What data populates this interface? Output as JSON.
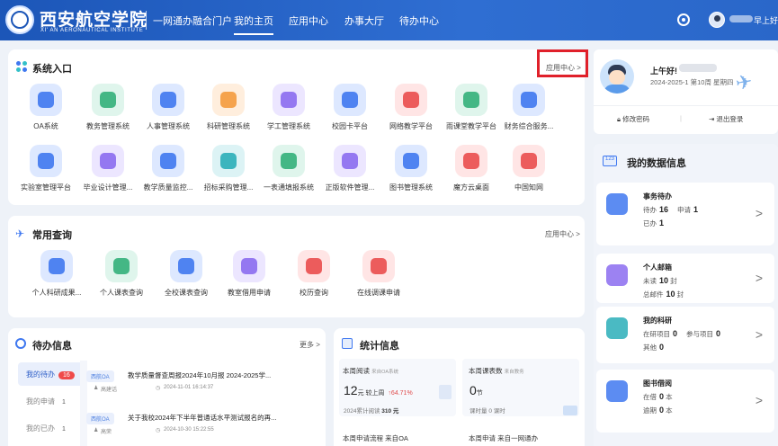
{
  "header": {
    "logo_text": "西安航空学院",
    "logo_en": "XI' AN AERONAUTICAL INSTITUTE",
    "portal_title": "一网通办融合门户",
    "nav": [
      "我的主页",
      "应用中心",
      "办事大厅",
      "待办中心"
    ],
    "active_nav": "我的主页",
    "greeting": "早上好",
    "icons": [
      "gear-icon",
      "avatar-icon"
    ]
  },
  "system_entry": {
    "title": "系统入口",
    "more": "应用中心 >",
    "apps": [
      {
        "label": "OA系统",
        "color": "blue"
      },
      {
        "label": "教务管理系统",
        "color": "green"
      },
      {
        "label": "人事管理系统",
        "color": "blue"
      },
      {
        "label": "科研管理系统",
        "color": "orange"
      },
      {
        "label": "学工管理系统",
        "color": "purple"
      },
      {
        "label": "校园卡平台",
        "color": "blue"
      },
      {
        "label": "网络教学平台",
        "color": "red"
      },
      {
        "label": "雨课堂教学平台",
        "color": "green"
      },
      {
        "label": "财务综合服务...",
        "color": "blue"
      },
      {
        "label": "实验室管理平台",
        "color": "blue"
      },
      {
        "label": "毕业设计管理...",
        "color": "purple"
      },
      {
        "label": "教学质量监控...",
        "color": "blue"
      },
      {
        "label": "招标采购管理...",
        "color": "teal"
      },
      {
        "label": "一表通填报系统",
        "color": "green"
      },
      {
        "label": "正版软件管理...",
        "color": "purple"
      },
      {
        "label": "图书管理系统",
        "color": "blue"
      },
      {
        "label": "魔方云桌面",
        "color": "red"
      },
      {
        "label": "中国知网",
        "color": "red"
      }
    ]
  },
  "common_query": {
    "title": "常用查询",
    "more": "应用中心 >",
    "items": [
      {
        "label": "个人科研成果...",
        "color": "blue"
      },
      {
        "label": "个人课表查询",
        "color": "green"
      },
      {
        "label": "全校课表查询",
        "color": "blue"
      },
      {
        "label": "教室借用申请",
        "color": "purple"
      },
      {
        "label": "校历查询",
        "color": "red"
      },
      {
        "label": "在线调课申请",
        "color": "red"
      }
    ]
  },
  "todo": {
    "title": "待办信息",
    "more": "更多 >",
    "tabs": [
      {
        "label": "我的待办",
        "count": "16"
      },
      {
        "label": "我的申请",
        "count": "1"
      },
      {
        "label": "我的已办",
        "count": "1"
      }
    ],
    "items": [
      {
        "tag": "西航OA",
        "title": "教学质量督查周报2024年10月报 2024-2025学...",
        "author": "高建话",
        "time": "2024-11-01 16:14:37"
      },
      {
        "tag": "西航OA",
        "title": "关于我校2024年下半年普通话水平测试报名的再...",
        "author": "高荣",
        "time": "2024-10-30 15:22:55"
      }
    ]
  },
  "stats": {
    "title": "统计信息",
    "items": [
      {
        "label": "本周阅读",
        "sub": "来自OA系统",
        "value": "12",
        "unit": "元 较上周",
        "change": "64.71%",
        "foot": "2024累计阅读",
        "foot_value": "310 元"
      },
      {
        "label": "本周课表数",
        "sub": "来自教务",
        "value": "0",
        "unit": "节",
        "foot": "课时量",
        "foot_value": "0 课时"
      }
    ],
    "footer_labels": [
      "本周申请流程 来自OA",
      "本周申请 来自一网通办"
    ]
  },
  "profile": {
    "greeting": "上午好!",
    "term": "2024-2025-1 第10周 星期四",
    "actions": [
      "修改密码",
      "退出登录"
    ]
  },
  "data_info": {
    "title": "我的数据信息",
    "cards": [
      {
        "title": "事务待办",
        "lines": [
          [
            {
              "k": "待办",
              "v": "16"
            },
            {
              "k": "申请",
              "v": "1"
            }
          ],
          [
            {
              "k": "已办",
              "v": "1"
            }
          ]
        ],
        "color": "#3f78f0"
      },
      {
        "title": "个人邮箱",
        "lines": [
          [
            {
              "k": "未读",
              "v": "10",
              "u": "封"
            }
          ],
          [
            {
              "k": "总邮件",
              "v": "10",
              "u": "封"
            }
          ]
        ],
        "color": "#8b6cf0"
      },
      {
        "title": "我的科研",
        "lines": [
          [
            {
              "k": "在研项目",
              "v": "0"
            },
            {
              "k": "参与项目",
              "v": "0"
            }
          ],
          [
            {
              "k": "其他",
              "v": "0"
            }
          ]
        ],
        "color": "#2aaeb8"
      },
      {
        "title": "图书借阅",
        "lines": [
          [
            {
              "k": "在借",
              "v": "0",
              "u": "本"
            }
          ],
          [
            {
              "k": "逾期",
              "v": "0",
              "u": "本"
            }
          ]
        ],
        "color": "#3f78f0"
      }
    ]
  },
  "colors": {
    "primary": "#2a63c6",
    "accent_red": "#e0202a"
  }
}
